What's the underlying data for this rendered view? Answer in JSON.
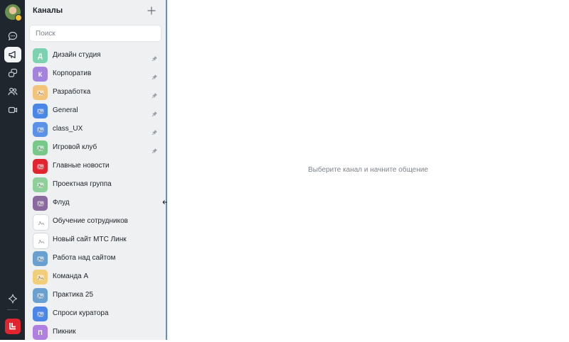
{
  "rail": {
    "items": [
      {
        "icon": "chat-bubble-icon",
        "active": false
      },
      {
        "icon": "megaphone-icon",
        "active": true
      },
      {
        "icon": "threads-icon",
        "active": false
      },
      {
        "icon": "contacts-icon",
        "active": false
      },
      {
        "icon": "video-call-icon",
        "active": false
      }
    ],
    "bottom_icon": "sparkle-icon",
    "brand_color": "#e1252f"
  },
  "sidebar": {
    "title": "Каналы",
    "search_placeholder": "Поиск",
    "channels": [
      {
        "name": "Дизайн студия",
        "letter": "Д",
        "color": "#7cd1b0",
        "pinned": true
      },
      {
        "name": "Корпоратив",
        "letter": "К",
        "color": "#a483de",
        "pinned": true
      },
      {
        "name": "Разработка",
        "letter": "",
        "color": "#f2c47a",
        "pinned": true
      },
      {
        "name": "General",
        "letter": "",
        "color": "#4a86e8",
        "pinned": true
      },
      {
        "name": "class_UX",
        "letter": "",
        "color": "#5b91e6",
        "pinned": true
      },
      {
        "name": "Игровой клуб",
        "letter": "",
        "color": "#78c88a",
        "pinned": true
      },
      {
        "name": "Главные новости",
        "letter": "",
        "color": "#e1252f",
        "pinned": false
      },
      {
        "name": "Проектная группа",
        "letter": "",
        "color": "#8ecf9a",
        "pinned": false
      },
      {
        "name": "Флуд",
        "letter": "",
        "color": "#8a6a9e",
        "pinned": false
      },
      {
        "name": "Обучение сотрудников",
        "letter": "",
        "color": "#ffffff",
        "pinned": false
      },
      {
        "name": "Новый сайт МТС Линк",
        "letter": "",
        "color": "#ffffff",
        "pinned": false
      },
      {
        "name": "Работа над сайтом",
        "letter": "",
        "color": "#6aa0d0",
        "pinned": false
      },
      {
        "name": "Команда А",
        "letter": "",
        "color": "#f1cf7a",
        "pinned": false
      },
      {
        "name": "Практика 25",
        "letter": "",
        "color": "#6aa0d0",
        "pinned": false
      },
      {
        "name": "Спроси куратора",
        "letter": "",
        "color": "#4a86e8",
        "pinned": false
      },
      {
        "name": "Пикник",
        "letter": "П",
        "color": "#b07fe0",
        "pinned": false
      }
    ]
  },
  "main": {
    "placeholder": "Выберите канал и начните общение"
  }
}
